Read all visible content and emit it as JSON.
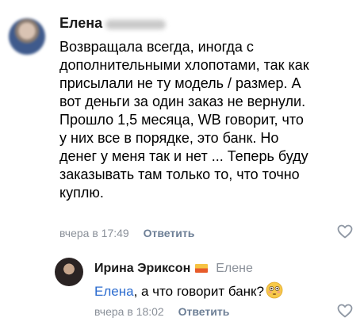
{
  "comment": {
    "author": "Елена",
    "lines": [
      "Возвращала всегда, иногда с",
      "дополнительными хлопотами, так как",
      "присылали не ту модель / размер. А",
      "вот деньги за один заказ не вернули.",
      "Прошло 1,5 месяца, WB говорит, что",
      "у них все в порядке, это банк. Но",
      "денег у меня так и нет ... Теперь буду",
      "заказывать там только то, что точно",
      "куплю."
    ],
    "time": "вчера в 17:49",
    "reply_label": "Ответить"
  },
  "reply": {
    "author": "Ирина Эриксон",
    "reply_to": "Елене",
    "mention": "Елена",
    "text": ", а что говорит банк?",
    "time": "вчера в 18:02",
    "reply_label": "Ответить"
  },
  "colors": {
    "meta": "#8a9099",
    "reply_link": "#6d7f96",
    "mention": "#2c6ccf"
  },
  "icons": [
    "heart-outline-icon",
    "flushed-face-emoji",
    "flag-badge-icon"
  ]
}
